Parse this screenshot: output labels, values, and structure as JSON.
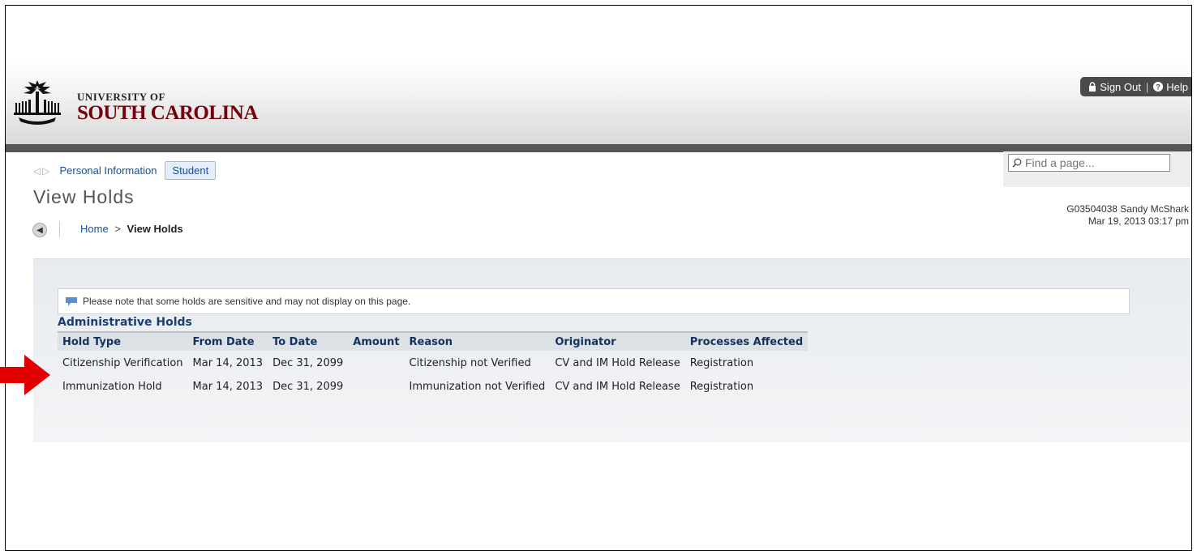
{
  "header": {
    "logo_line1": "UNIVERSITY OF",
    "logo_line2": "SOUTH CAROLINA",
    "sign_out": "Sign Out",
    "help": "Help",
    "separator": "|"
  },
  "nav": {
    "personal_info": "Personal Information",
    "student": "Student"
  },
  "search": {
    "placeholder": "Find a page..."
  },
  "page": {
    "title": "View Holds"
  },
  "breadcrumb": {
    "home": "Home",
    "arrow": ">",
    "current": "View Holds"
  },
  "user": {
    "id_name": "G03504038 Sandy McShark",
    "datetime": "Mar 19, 2013 03:17 pm"
  },
  "notice": "Please note that some holds are sensitive and may not display on this page.",
  "section_title": "Administrative Holds",
  "table": {
    "headers": [
      "Hold Type",
      "From Date",
      "To Date",
      "Amount",
      "Reason",
      "Originator",
      "Processes Affected"
    ],
    "rows": [
      [
        "Citizenship Verification",
        "Mar 14, 2013",
        "Dec 31, 2099",
        "",
        "Citizenship not Verified",
        "CV and IM Hold Release",
        "Registration"
      ],
      [
        "Immunization Hold",
        "Mar 14, 2013",
        "Dec 31, 2099",
        "",
        "Immunization not Verified",
        "CV and IM Hold Release",
        "Registration"
      ]
    ]
  },
  "colors": {
    "brand": "#73000a",
    "link": "#1b4e8c",
    "annotation_arrow": "#e00000"
  }
}
